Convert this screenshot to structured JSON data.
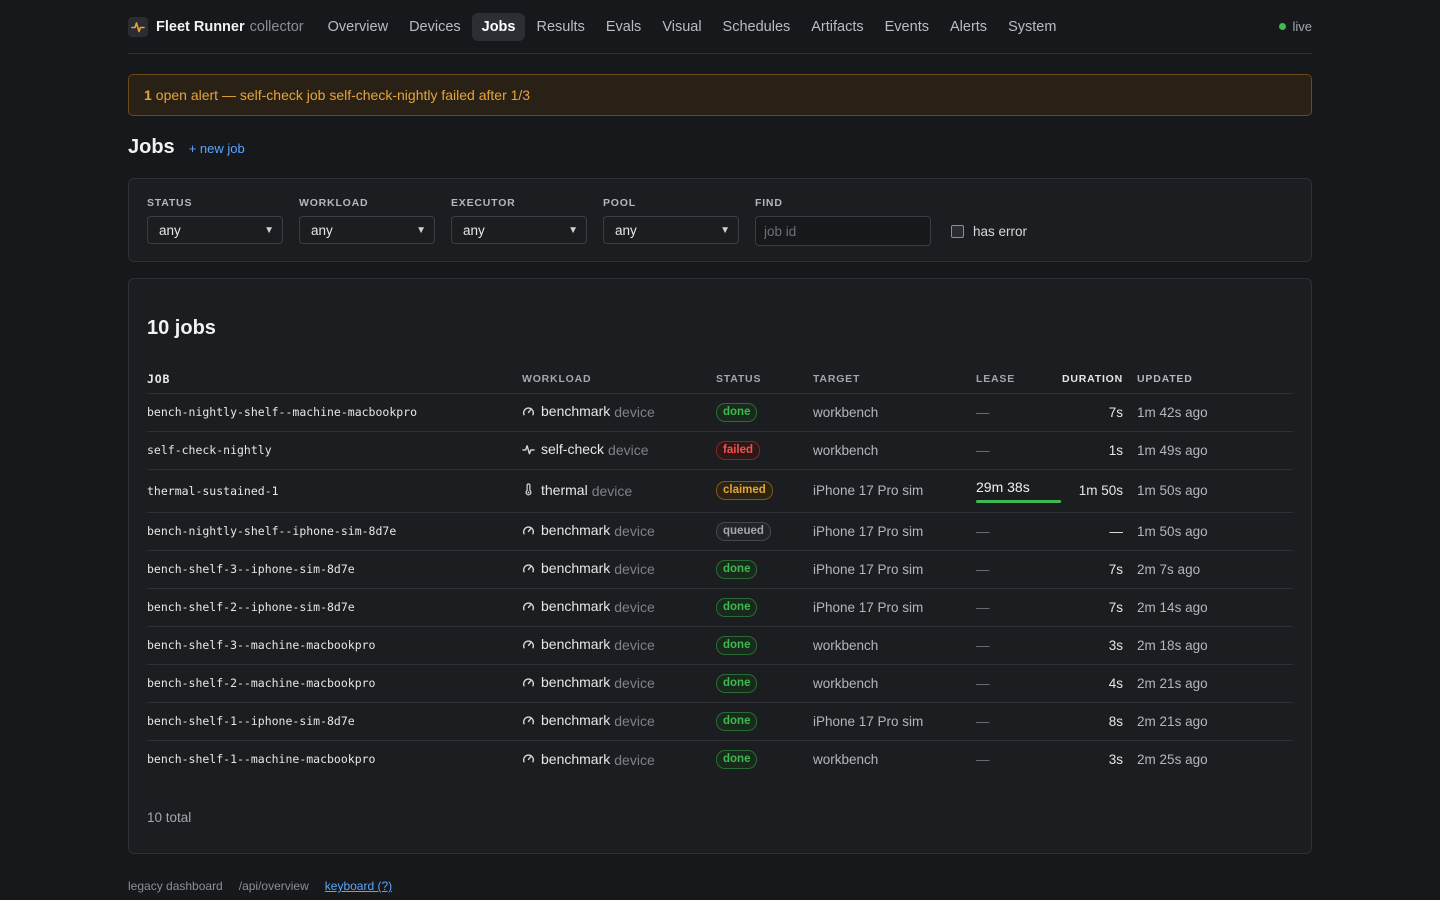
{
  "brand": {
    "name": "Fleet Runner",
    "sub": "collector"
  },
  "nav": [
    {
      "label": "Overview",
      "active": false
    },
    {
      "label": "Devices",
      "active": false
    },
    {
      "label": "Jobs",
      "active": true
    },
    {
      "label": "Results",
      "active": false
    },
    {
      "label": "Evals",
      "active": false
    },
    {
      "label": "Visual",
      "active": false
    },
    {
      "label": "Schedules",
      "active": false
    },
    {
      "label": "Artifacts",
      "active": false
    },
    {
      "label": "Events",
      "active": false
    },
    {
      "label": "Alerts",
      "active": false
    },
    {
      "label": "System",
      "active": false
    }
  ],
  "live": {
    "label": "live",
    "color": "#3fb950"
  },
  "alert": {
    "count": "1",
    "text": "open alert — self-check job self-check-nightly failed after 1/3"
  },
  "page": {
    "title": "Jobs",
    "new_job": "+ new job"
  },
  "filters": {
    "status": {
      "label": "STATUS",
      "value": "any"
    },
    "workload": {
      "label": "WORKLOAD",
      "value": "any"
    },
    "executor": {
      "label": "EXECUTOR",
      "value": "any"
    },
    "pool": {
      "label": "POOL",
      "value": "any"
    },
    "find": {
      "label": "FIND",
      "placeholder": "job id",
      "value": ""
    },
    "has_error": {
      "label": "has error",
      "checked": false
    }
  },
  "table": {
    "title": "10 jobs",
    "headers": {
      "job": "JOB",
      "workload": "WORKLOAD",
      "status": "STATUS",
      "target": "TARGET",
      "lease": "LEASE",
      "duration": "DURATION",
      "updated": "UPDATED"
    },
    "rows": [
      {
        "job": "bench-nightly-shelf--machine-macbookpro",
        "workload_icon": "gauge-icon",
        "workload": "benchmark",
        "kind": "device",
        "status": "done",
        "target": "workbench",
        "lease": "—",
        "duration": "7s",
        "updated": "1m 42s ago"
      },
      {
        "job": "self-check-nightly",
        "workload_icon": "pulse-icon",
        "workload": "self-check",
        "kind": "device",
        "status": "failed",
        "target": "workbench",
        "lease": "—",
        "duration": "1s",
        "updated": "1m 49s ago"
      },
      {
        "job": "thermal-sustained-1",
        "workload_icon": "thermometer-icon",
        "workload": "thermal",
        "kind": "device",
        "status": "claimed",
        "target": "iPhone 17 Pro sim",
        "lease": "29m 38s",
        "lease_progress": 0.99,
        "duration": "1m 50s",
        "updated": "1m 50s ago"
      },
      {
        "job": "bench-nightly-shelf--iphone-sim-8d7e",
        "workload_icon": "gauge-icon",
        "workload": "benchmark",
        "kind": "device",
        "status": "queued",
        "target": "iPhone 17 Pro sim",
        "lease": "—",
        "duration": "—",
        "updated": "1m 50s ago"
      },
      {
        "job": "bench-shelf-3--iphone-sim-8d7e",
        "workload_icon": "gauge-icon",
        "workload": "benchmark",
        "kind": "device",
        "status": "done",
        "target": "iPhone 17 Pro sim",
        "lease": "—",
        "duration": "7s",
        "updated": "2m 7s ago"
      },
      {
        "job": "bench-shelf-2--iphone-sim-8d7e",
        "workload_icon": "gauge-icon",
        "workload": "benchmark",
        "kind": "device",
        "status": "done",
        "target": "iPhone 17 Pro sim",
        "lease": "—",
        "duration": "7s",
        "updated": "2m 14s ago"
      },
      {
        "job": "bench-shelf-3--machine-macbookpro",
        "workload_icon": "gauge-icon",
        "workload": "benchmark",
        "kind": "device",
        "status": "done",
        "target": "workbench",
        "lease": "—",
        "duration": "3s",
        "updated": "2m 18s ago"
      },
      {
        "job": "bench-shelf-2--machine-macbookpro",
        "workload_icon": "gauge-icon",
        "workload": "benchmark",
        "kind": "device",
        "status": "done",
        "target": "workbench",
        "lease": "—",
        "duration": "4s",
        "updated": "2m 21s ago"
      },
      {
        "job": "bench-shelf-1--iphone-sim-8d7e",
        "workload_icon": "gauge-icon",
        "workload": "benchmark",
        "kind": "device",
        "status": "done",
        "target": "iPhone 17 Pro sim",
        "lease": "—",
        "duration": "8s",
        "updated": "2m 21s ago"
      },
      {
        "job": "bench-shelf-1--machine-macbookpro",
        "workload_icon": "gauge-icon",
        "workload": "benchmark",
        "kind": "device",
        "status": "done",
        "target": "workbench",
        "lease": "—",
        "duration": "3s",
        "updated": "2m 25s ago"
      }
    ],
    "total": "10 total"
  },
  "footer": {
    "legacy": "legacy dashboard",
    "api": "/api/overview",
    "keyboard": "keyboard (?)"
  },
  "colors": {
    "accent": "#58a6ff",
    "done": "#3fb950",
    "failed": "#f85149",
    "claimed": "#e3a53a",
    "queued": "#a3a7ad",
    "alert": "#e3a53a"
  }
}
